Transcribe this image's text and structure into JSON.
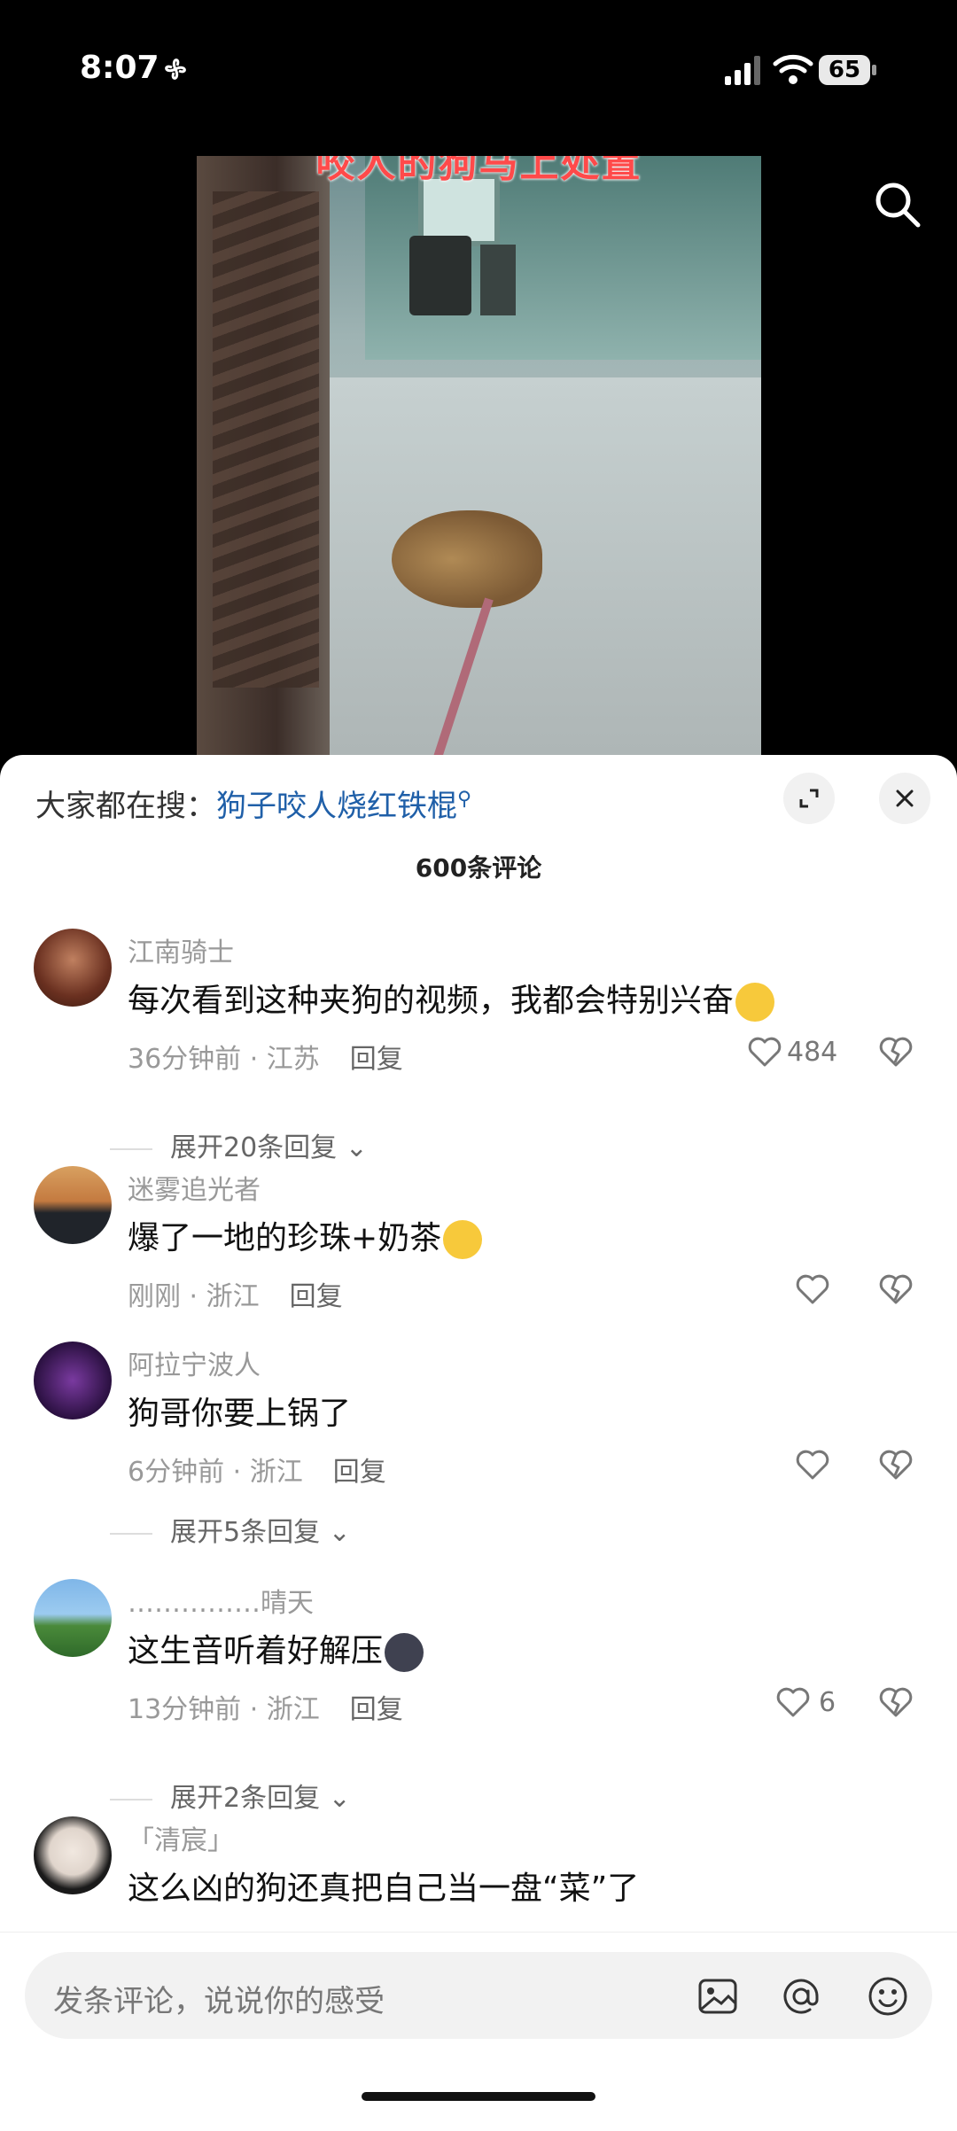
{
  "status_bar": {
    "time": "8:07",
    "battery": "65"
  },
  "video": {
    "caption": "咬人的狗马上处置"
  },
  "hot_search": {
    "prefix": "大家都在搜：",
    "keyword": "狗子咬人烧红铁棍"
  },
  "comment_count": "600条评论",
  "comments": [
    {
      "user": "江南骑士",
      "text": "每次看到这种夹狗的视频，我都会特别兴奋",
      "meta": "36分钟前 · 江苏",
      "reply": "回复",
      "likes": "484",
      "more": "展开20条回复"
    },
    {
      "user": "迷雾追光者",
      "text": "爆了一地的珍珠+奶茶",
      "meta": "刚刚 · 浙江",
      "reply": "回复",
      "likes": "",
      "more": ""
    },
    {
      "user": "阿拉宁波人",
      "text": "狗哥你要上锅了",
      "meta": "6分钟前 · 浙江",
      "reply": "回复",
      "likes": "",
      "more": "展开5条回复"
    },
    {
      "user": "……………晴天",
      "text": "这生音听着好解压",
      "meta": "13分钟前 · 浙江",
      "reply": "回复",
      "likes": "6",
      "more": "展开2条回复"
    },
    {
      "user": "「清宸」",
      "text": "这么凶的狗还真把自己当一盘“菜”了",
      "meta": "",
      "reply": "",
      "likes": "",
      "more": ""
    }
  ],
  "input": {
    "placeholder": "发条评论，说说你的感受"
  },
  "icons": [
    "fan-icon",
    "signal-icon",
    "wifi-icon",
    "battery-icon",
    "search-icon",
    "expand-icon",
    "close-icon",
    "heart-icon",
    "broken-heart-icon",
    "image-icon",
    "at-icon",
    "emoji-icon"
  ]
}
